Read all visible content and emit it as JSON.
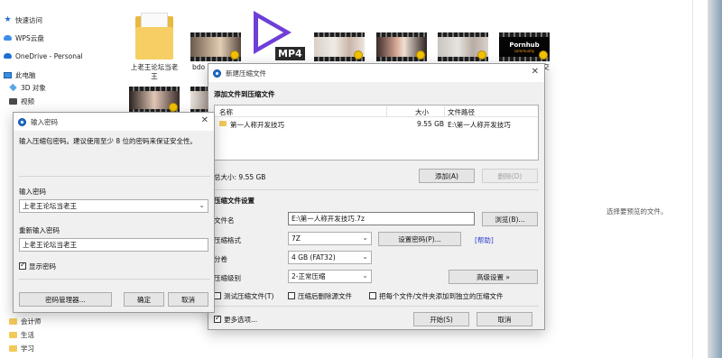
{
  "explorer": {
    "nav": [
      {
        "label": "快速访问",
        "icon": "star-icon"
      },
      {
        "label": "WPS云盘",
        "icon": "cloud-icon"
      },
      {
        "label": "OneDrive - Personal",
        "icon": "onedrive-icon"
      },
      {
        "label": "此电脑",
        "icon": "pc-icon"
      },
      {
        "label": "3D 对象",
        "icon": "cube-icon"
      },
      {
        "label": "视频",
        "icon": "video-icon"
      },
      {
        "label": "会计师",
        "icon": "folder-icon"
      },
      {
        "label": "生活",
        "icon": "folder-icon"
      },
      {
        "label": "学习",
        "icon": "folder-icon"
      }
    ],
    "folder_label_line1": "上老王论坛当老",
    "folder_label_line2": "王",
    "file_label_partial": "bdo",
    "file_label_right": "交",
    "mp4_label": "MP4",
    "pornhub_text": "Pornhub",
    "pornhub_sub": "community",
    "preview_text": "选择要预览的文件。"
  },
  "password_dialog": {
    "title": "输入密码",
    "instruction": "输入压缩包密码。建议使用至少 8 位的密码来保证安全性。",
    "enter_label": "输入密码",
    "enter_value": "上老王论坛当老王",
    "reenter_label": "重新输入密码",
    "reenter_value": "上老王论坛当老王",
    "show_password_label": "显示密码",
    "show_password_checked": true,
    "manager_button": "密码管理器...",
    "ok_button": "确定",
    "cancel_button": "取消"
  },
  "archive_dialog": {
    "title": "新建压缩文件",
    "section_add": "添加文件到压缩文件",
    "columns": {
      "name": "名称",
      "size": "大小",
      "path": "文件路径"
    },
    "rows": [
      {
        "name": "第一人称开发技巧",
        "size": "9.55 GB",
        "path": "E:\\第一人称开发技巧"
      }
    ],
    "total_size": "总大小: 9.55 GB",
    "add_button": "添加(A)",
    "delete_button": "删除(D)",
    "section_settings": "压缩文件设置",
    "filename_label": "文件名",
    "filename_value": "E:\\第一人称开发技巧.7z",
    "browse_button": "浏览(B)...",
    "format_label": "压缩格式",
    "format_value": "7Z",
    "set_password_button": "设置密码(P)...",
    "help_link": "[帮助]",
    "split_label": "分卷",
    "split_value": "4 GB (FAT32)",
    "level_label": "压缩级别",
    "level_value": "2-正常压缩",
    "advanced_button": "高级设置 »",
    "opt_test": "测试压缩文件(T)",
    "opt_delete": "压缩后删除源文件",
    "opt_separate": "把每个文件/文件夹添加到独立的压缩文件",
    "more_options": "更多选项...",
    "more_options_checked": true,
    "start_button": "开始(S)",
    "cancel_button": "取消"
  }
}
